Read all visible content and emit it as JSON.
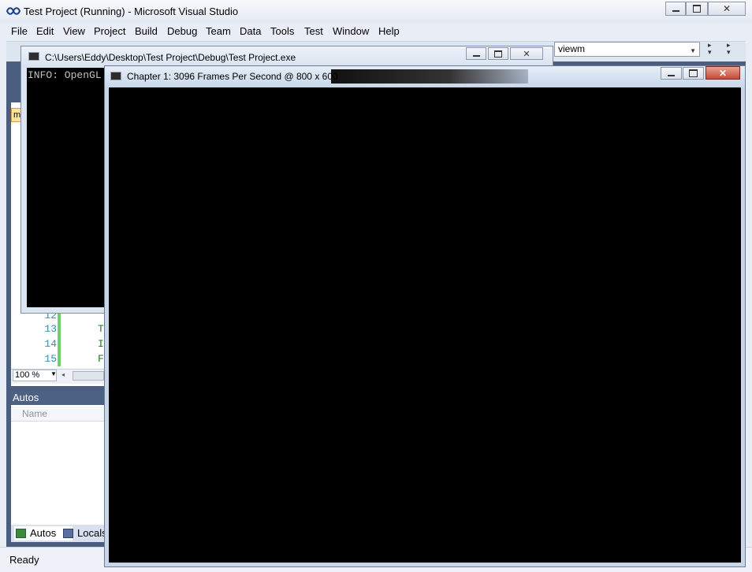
{
  "vs": {
    "title": "Test Project (Running) - Microsoft Visual Studio",
    "menu": [
      "File",
      "Edit",
      "View",
      "Project",
      "Build",
      "Debug",
      "Team",
      "Data",
      "Tools",
      "Test",
      "Window",
      "Help"
    ],
    "toolbar": {
      "config_combo_value": "viewm"
    },
    "editor": {
      "doc_tab_label": "m",
      "line_numbers": [
        "12",
        "13",
        "14",
        "15"
      ],
      "code_fragments": [
        "T",
        "I",
        "F"
      ],
      "zoom": "100 %"
    },
    "autos": {
      "title": "Autos",
      "column_name": "Name",
      "tabs": [
        "Autos",
        "Locals"
      ]
    },
    "status": "Ready"
  },
  "console": {
    "title": "C:\\Users\\Eddy\\Desktop\\Test Project\\Debug\\Test Project.exe",
    "text": "INFO: OpenGL"
  },
  "gl_window": {
    "title": "Chapter 1: 3096 Frames Per Second @ 800 x 600"
  },
  "colors": {
    "accent_panel": "#4c6184",
    "close_button": "#c94a36",
    "canvas": "#000000"
  }
}
